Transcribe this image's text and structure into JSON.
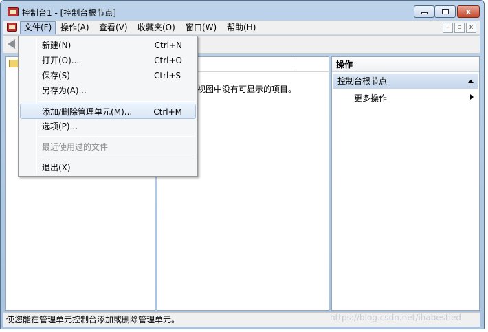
{
  "window": {
    "title": "控制台1 - [控制台根节点]",
    "controls": {
      "close": "x"
    }
  },
  "menubar": {
    "items": [
      "文件(F)",
      "操作(A)",
      "查看(V)",
      "收藏夹(O)",
      "窗口(W)",
      "帮助(H)"
    ],
    "active": "文件(F)"
  },
  "mdi_controls": [
    "–",
    "▫",
    "x"
  ],
  "file_menu": {
    "items": [
      {
        "label": "新建(N)",
        "shortcut": "Ctrl+N"
      },
      {
        "label": "打开(O)...",
        "shortcut": "Ctrl+O"
      },
      {
        "label": "保存(S)",
        "shortcut": "Ctrl+S"
      },
      {
        "label": "另存为(A)...",
        "shortcut": ""
      },
      {
        "label": "添加/删除管理单元(M)...",
        "shortcut": "Ctrl+M",
        "highlighted": true
      },
      {
        "label": "选项(P)...",
        "shortcut": ""
      },
      {
        "label": "最近使用过的文件",
        "shortcut": "",
        "disabled": true
      },
      {
        "label": "退出(X)",
        "shortcut": ""
      }
    ]
  },
  "center_pane": {
    "empty_message": "视图中没有可显示的项目。"
  },
  "actions_pane": {
    "title": "操作",
    "node": "控制台根节点",
    "more": "更多操作"
  },
  "statusbar": {
    "text": "使您能在管理单元控制台添加或删除管理单元。"
  },
  "watermark": "https://blog.csdn.net/ihabestied",
  "colors": {
    "menu_highlight": "#c1d4ec",
    "actions_header": "#c5d6ec",
    "close_button": "#c6482c"
  }
}
